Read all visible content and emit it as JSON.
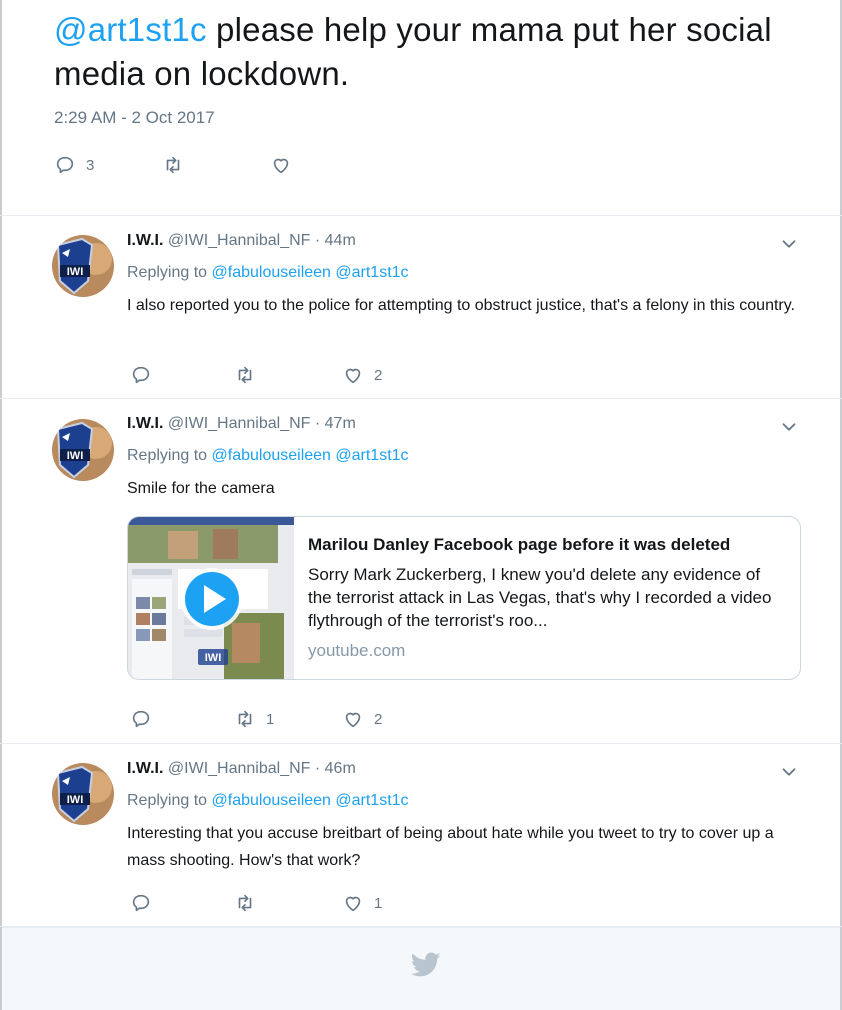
{
  "main_tweet": {
    "mention": "@art1st1c",
    "text": " please help your mama put her social media on lockdown.",
    "timestamp": "2:29 AM - 2 Oct 2017",
    "reply_count": "3",
    "retweet_count": "",
    "like_count": ""
  },
  "replies": [
    {
      "name": "I.W.I.",
      "handle": "@IWI_Hannibal_NF",
      "time": "· 44m",
      "replying_prefix": "Replying to ",
      "replying_to_1": "@fabulouseileen",
      "replying_to_2": "@art1st1c",
      "text": "I also reported you to the police for attempting to obstruct justice, that's a felony in this country.",
      "reply_count": "",
      "retweet_count": "",
      "like_count": "2"
    },
    {
      "name": "I.W.I.",
      "handle": "@IWI_Hannibal_NF",
      "time": "· 47m",
      "replying_prefix": "Replying to ",
      "replying_to_1": "@fabulouseileen",
      "replying_to_2": "@art1st1c",
      "text": "Smile for the camera",
      "card": {
        "title": "Marilou Danley Facebook page before it was deleted",
        "description": "Sorry Mark Zuckerberg, I knew you'd delete any evidence of the terrorist attack in Las Vegas, that's why I recorded a video flythrough of the terrorist's roo...",
        "domain": "youtube.com"
      },
      "reply_count": "",
      "retweet_count": "1",
      "like_count": "2"
    },
    {
      "name": "I.W.I.",
      "handle": "@IWI_Hannibal_NF",
      "time": "· 46m",
      "replying_prefix": "Replying to ",
      "replying_to_1": "@fabulouseileen",
      "replying_to_2": "@art1st1c",
      "text": "Interesting that you accuse breitbart of being about hate while you tweet to try to cover up a mass shooting.  How's that work?",
      "reply_count": "",
      "retweet_count": "",
      "like_count": "1"
    }
  ],
  "avatar_text": "IWI",
  "colors": {
    "accent": "#1da1f2",
    "muted": "#657786",
    "text": "#14171a",
    "border": "#e6ecf0",
    "footer_bg": "#f5f8fa"
  },
  "icons": [
    "reply-icon",
    "retweet-icon",
    "like-icon",
    "chevron-down-icon",
    "play-icon",
    "twitter-bird-icon"
  ]
}
